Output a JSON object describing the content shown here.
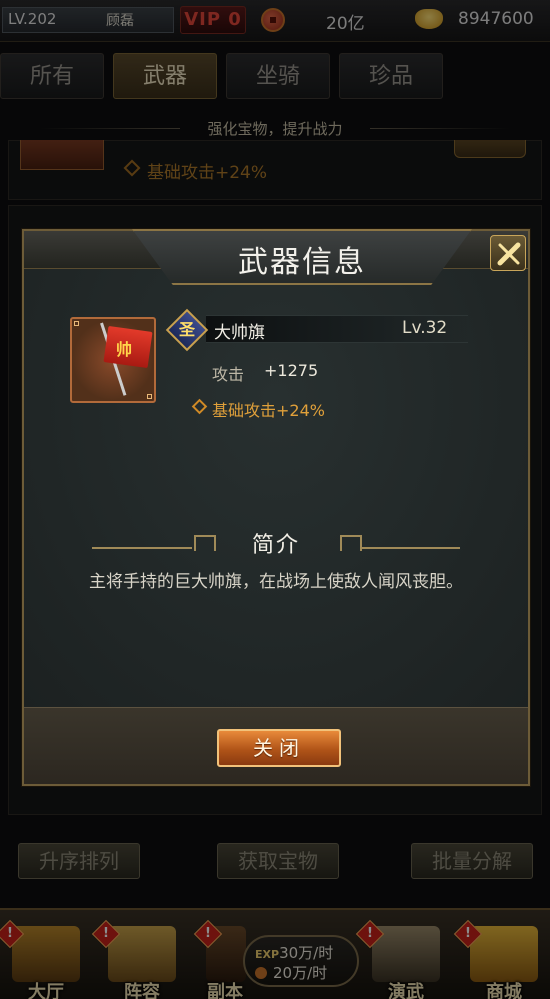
{
  "topbar": {
    "level": "LV.202",
    "player_name": "顾磊",
    "vip": "VIP 0",
    "coins": "20亿",
    "ingots": "8947600"
  },
  "tabs": [
    {
      "label": "所有",
      "active": false
    },
    {
      "label": "武器",
      "active": true
    },
    {
      "label": "坐骑",
      "active": false
    },
    {
      "label": "珍品",
      "active": false
    }
  ],
  "subtitle": "强化宝物，提升战力",
  "background_list": {
    "bonus_text": "基础攻击+24%"
  },
  "dialog": {
    "title": "武器信息",
    "item": {
      "rank_char": "圣",
      "name": "大帅旗",
      "level": "Lv.32",
      "attack_label": "攻击",
      "attack_value": "+1275",
      "bonus": "基础攻击+24%",
      "flag_char": "帅"
    },
    "section_title": "简介",
    "description": "主将手持的巨大帅旗，在战场上使敌人闻风丧胆。",
    "close_label": "关闭"
  },
  "actions": [
    {
      "label": "升序排列"
    },
    {
      "label": "获取宝物"
    },
    {
      "label": "批量分解"
    }
  ],
  "nav": [
    {
      "label": "大厅",
      "icon": "palace-icon"
    },
    {
      "label": "阵容",
      "icon": "banner-icon"
    },
    {
      "label": "副本",
      "icon": "hourglass-icon"
    },
    {
      "label": "演武",
      "icon": "crossed-swords-icon"
    },
    {
      "label": "商城",
      "icon": "treasure-icon"
    }
  ],
  "exp_box": {
    "exp_label": "EXP",
    "exp_rate": "30万/时",
    "coin_rate": "20万/时"
  },
  "colors": {
    "accent_gold": "#c8a050",
    "bonus_orange": "#e0a03a",
    "vip_red": "#e5483b",
    "close_button": "#d8762e"
  }
}
